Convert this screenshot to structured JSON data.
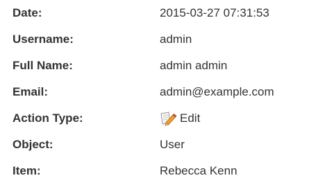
{
  "details": {
    "rows": [
      {
        "label": "Date:",
        "value": "2015-03-27 07:31:53"
      },
      {
        "label": "Username:",
        "value": "admin"
      },
      {
        "label": "Full Name:",
        "value": "admin admin"
      },
      {
        "label": "Email:",
        "value": "admin@example.com"
      },
      {
        "label": "Action Type:",
        "value": "Edit",
        "icon": "edit-icon"
      },
      {
        "label": "Object:",
        "value": "User"
      },
      {
        "label": "Item:",
        "value": "Rebecca Kenn"
      }
    ]
  }
}
